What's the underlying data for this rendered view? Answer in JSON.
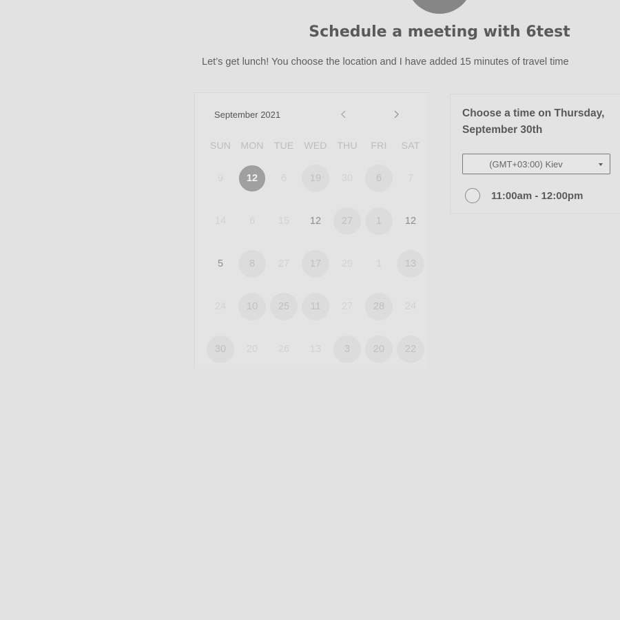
{
  "header": {
    "title": "Schedule a meeting with 6test",
    "subtitle": "Let’s get lunch! You choose the location and I have added 15 minutes of travel time"
  },
  "calendar": {
    "month_label": "September 2021",
    "prev_icon": "chevron-left-icon",
    "next_icon": "chevron-right-icon",
    "weekdays": [
      "SUN",
      "MON",
      "TUE",
      "WED",
      "THU",
      "FRI",
      "SAT"
    ],
    "weeks": [
      [
        {
          "label": "9",
          "state": "faint"
        },
        {
          "label": "12",
          "state": "selected"
        },
        {
          "label": "6",
          "state": "faint"
        },
        {
          "label": "19",
          "state": "avail"
        },
        {
          "label": "30",
          "state": "faint"
        },
        {
          "label": "6",
          "state": "avail"
        },
        {
          "label": "7",
          "state": "faint"
        }
      ],
      [
        {
          "label": "14",
          "state": "faint"
        },
        {
          "label": "6",
          "state": "faint"
        },
        {
          "label": "15",
          "state": "faint"
        },
        {
          "label": "12",
          "state": "dark"
        },
        {
          "label": "27",
          "state": "avail"
        },
        {
          "label": "1",
          "state": "avail"
        },
        {
          "label": "12",
          "state": "dark"
        }
      ],
      [
        {
          "label": "5",
          "state": "dark"
        },
        {
          "label": "8",
          "state": "avail"
        },
        {
          "label": "27",
          "state": "faint"
        },
        {
          "label": "17",
          "state": "avail"
        },
        {
          "label": "29",
          "state": "faint"
        },
        {
          "label": "1",
          "state": "faint"
        },
        {
          "label": "13",
          "state": "avail"
        }
      ],
      [
        {
          "label": "24",
          "state": "faint"
        },
        {
          "label": "10",
          "state": "avail"
        },
        {
          "label": "25",
          "state": "avail"
        },
        {
          "label": "11",
          "state": "avail"
        },
        {
          "label": "27",
          "state": "faint"
        },
        {
          "label": "28",
          "state": "avail"
        },
        {
          "label": "24",
          "state": "faint"
        }
      ],
      [
        {
          "label": "30",
          "state": "avail"
        },
        {
          "label": "20",
          "state": "faint"
        },
        {
          "label": "26",
          "state": "faint"
        },
        {
          "label": "13",
          "state": "faint"
        },
        {
          "label": "3",
          "state": "avail"
        },
        {
          "label": "20",
          "state": "avail"
        },
        {
          "label": "22",
          "state": "avail"
        }
      ]
    ]
  },
  "times": {
    "heading": "Choose a time on Thursday, September 30th",
    "timezone": "(GMT+03:00) Kiev",
    "slots": [
      {
        "label": "11:00am - 12:00pm"
      }
    ]
  },
  "colors": {
    "background": "#e2e2e2",
    "selected_day": "#a0a0a0",
    "avatar": "#868686"
  }
}
